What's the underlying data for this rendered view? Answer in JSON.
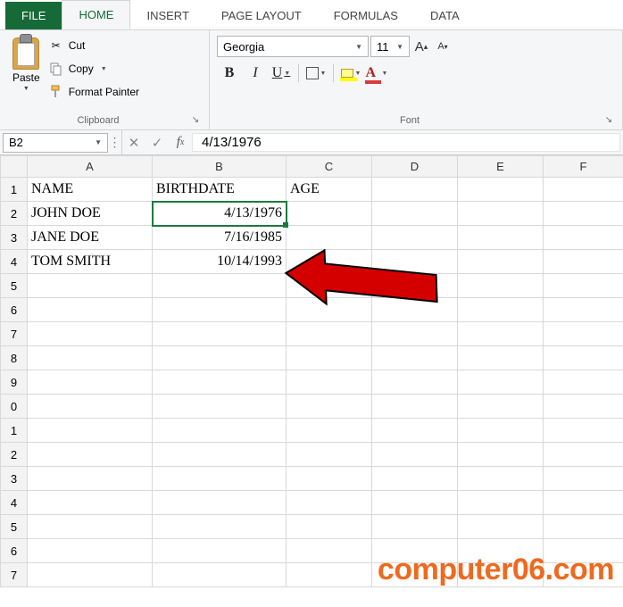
{
  "tabs": {
    "file": "FILE",
    "home": "HOME",
    "insert": "INSERT",
    "page_layout": "PAGE LAYOUT",
    "formulas": "FORMULAS",
    "data": "DATA"
  },
  "ribbon": {
    "clipboard": {
      "paste": "Paste",
      "cut": "Cut",
      "copy": "Copy",
      "format_painter": "Format Painter",
      "group_label": "Clipboard"
    },
    "font": {
      "font_name": "Georgia",
      "font_size": "11",
      "bold": "B",
      "italic": "I",
      "underline": "U",
      "font_color_letter": "A",
      "group_label": "Font"
    }
  },
  "namebox": "B2",
  "formula_bar_value": "4/13/1976",
  "columns": [
    "A",
    "B",
    "C",
    "D",
    "E",
    "F"
  ],
  "rows": {
    "1": {
      "A": "NAME",
      "B": "BIRTHDATE",
      "C": "AGE"
    },
    "2": {
      "A": "JOHN DOE",
      "B": "4/13/1976"
    },
    "3": {
      "A": "JANE DOE",
      "B": "7/16/1985"
    },
    "4": {
      "A": "TOM SMITH",
      "B": "10/14/1993"
    }
  },
  "active_cell": "B2",
  "watermark": "computer06.com"
}
